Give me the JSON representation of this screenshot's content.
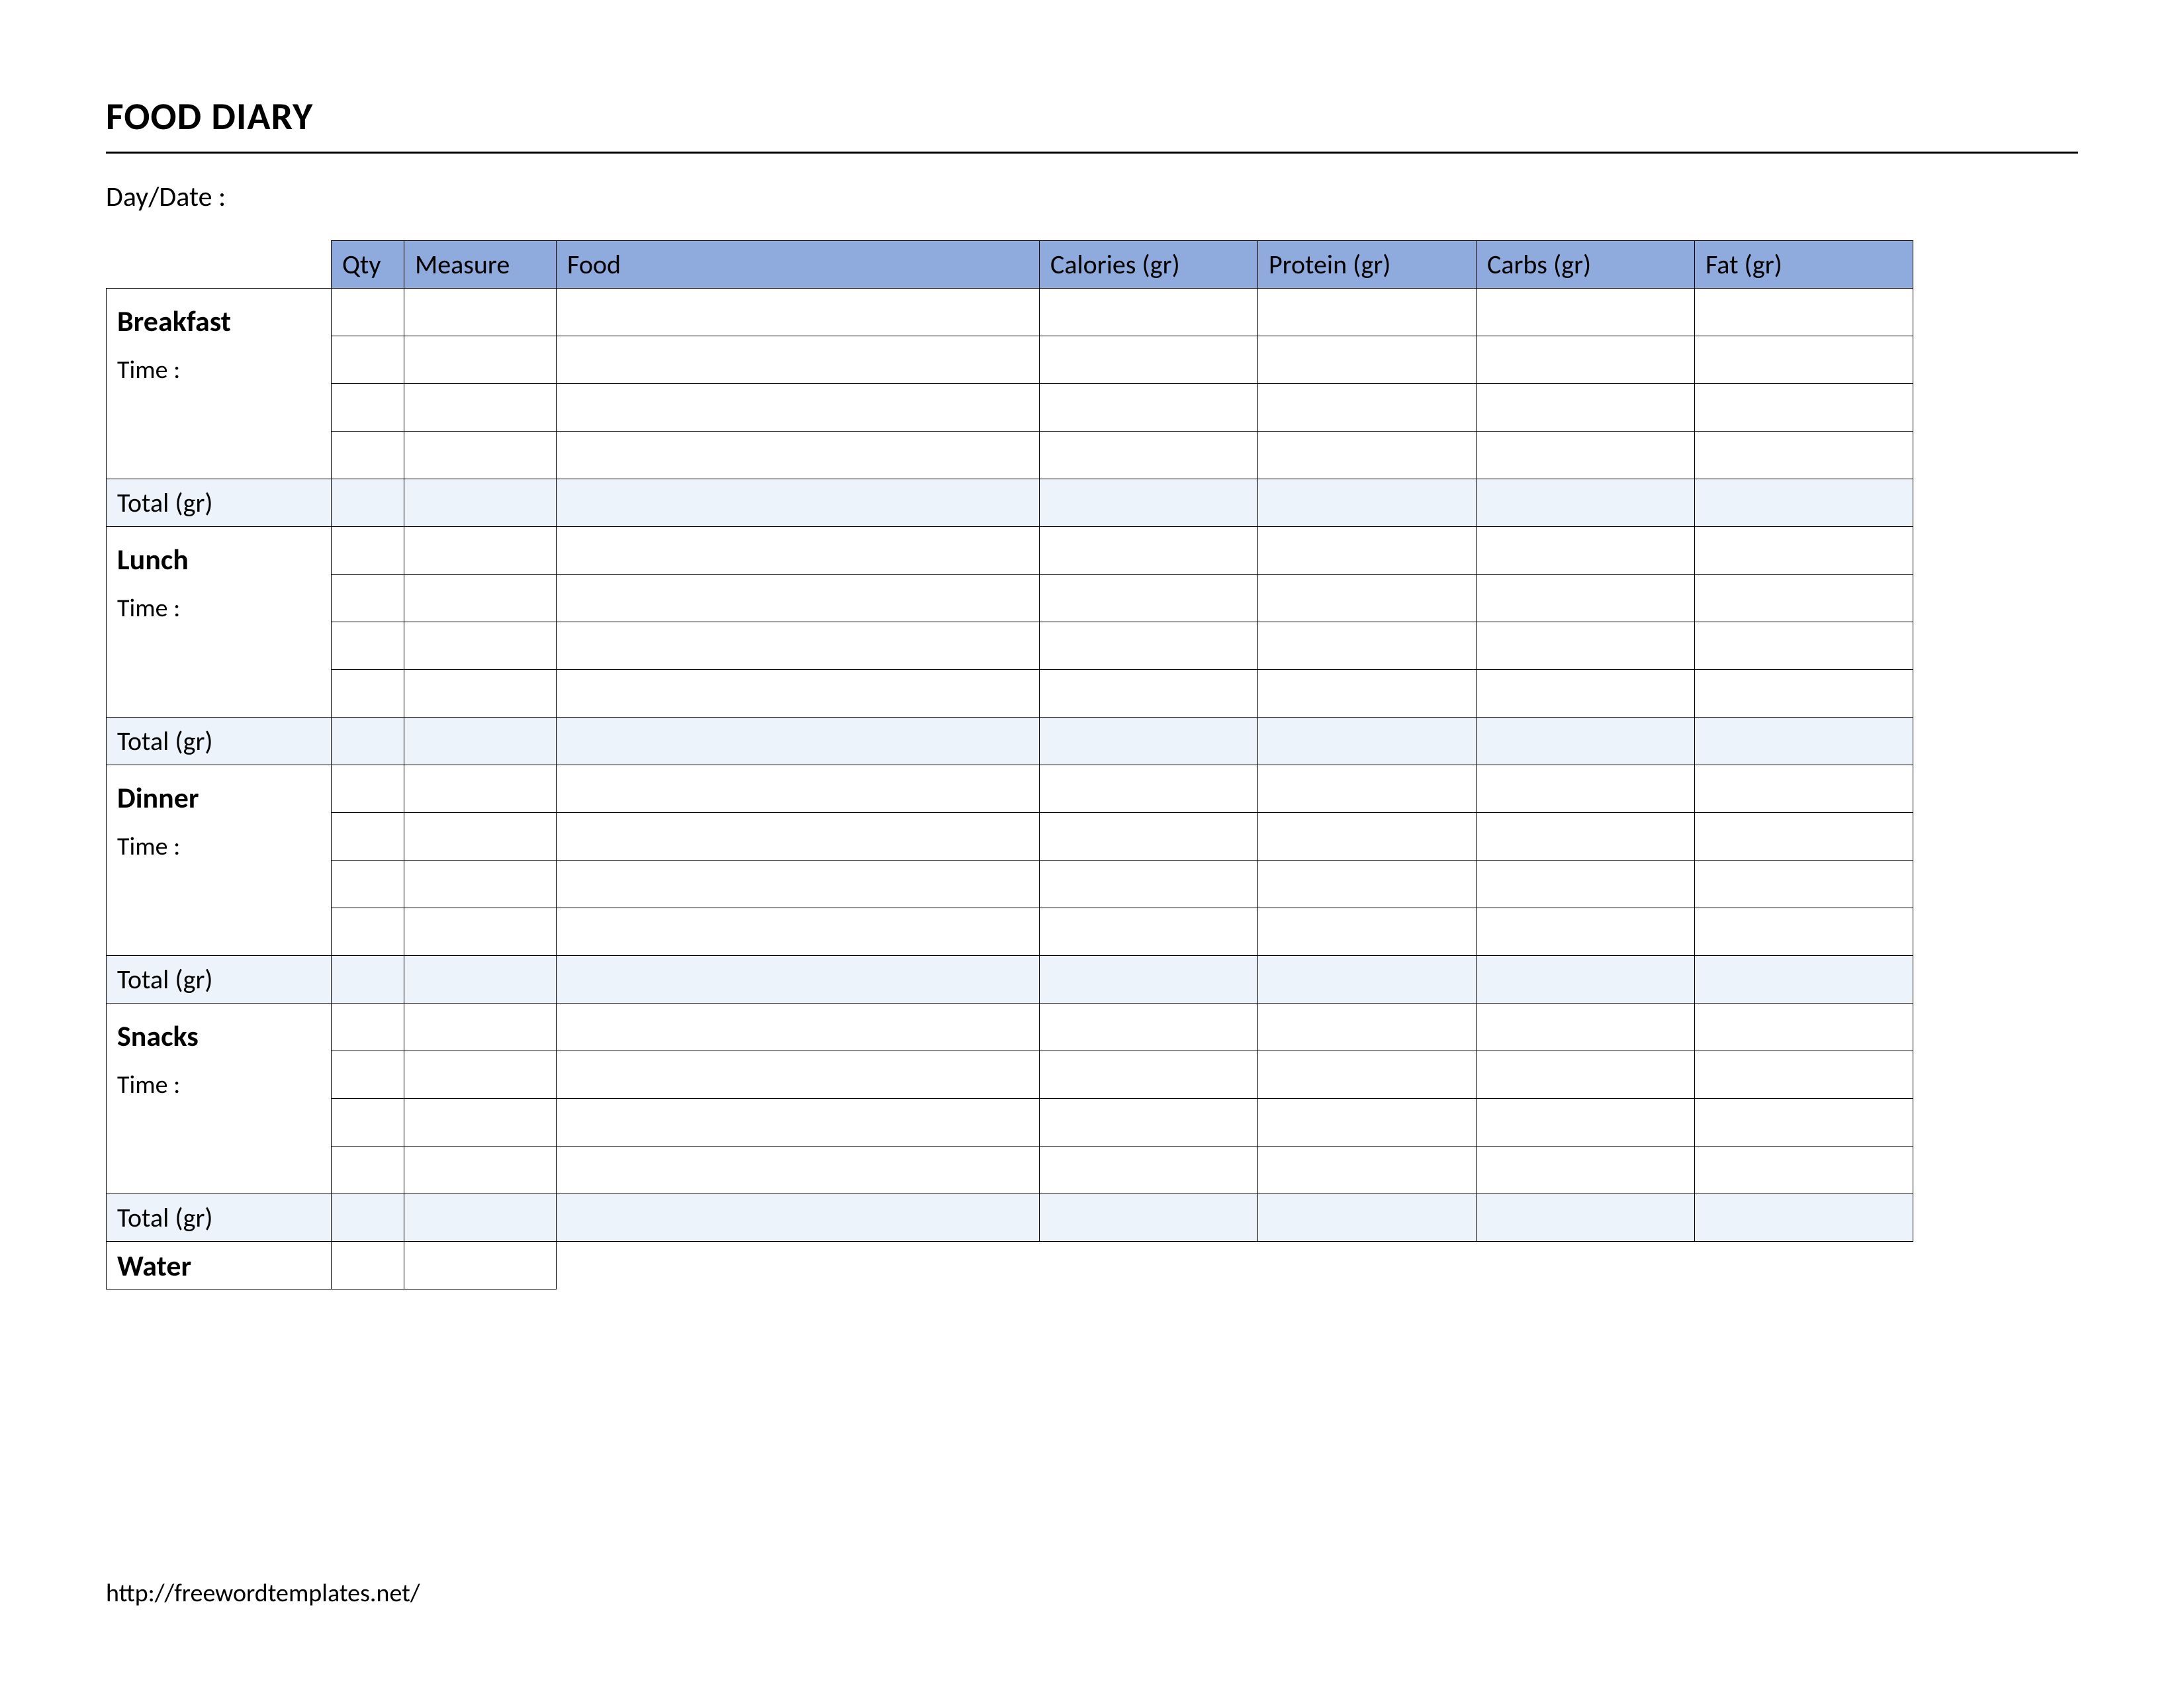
{
  "title": "FOOD DIARY",
  "daydate_label": "Day/Date :",
  "columns": {
    "qty": "Qty",
    "measure": "Measure",
    "food": "Food",
    "calories": "Calories (gr)",
    "protein": "Protein (gr)",
    "carbs": "Carbs (gr)",
    "fat": "Fat (gr)"
  },
  "time_label": "Time :",
  "total_label": "Total (gr)",
  "meals": {
    "breakfast": "Breakfast",
    "lunch": "Lunch",
    "dinner": "Dinner",
    "snacks": "Snacks"
  },
  "water_label": "Water",
  "footer_url": "http://freewordtemplates.net/"
}
